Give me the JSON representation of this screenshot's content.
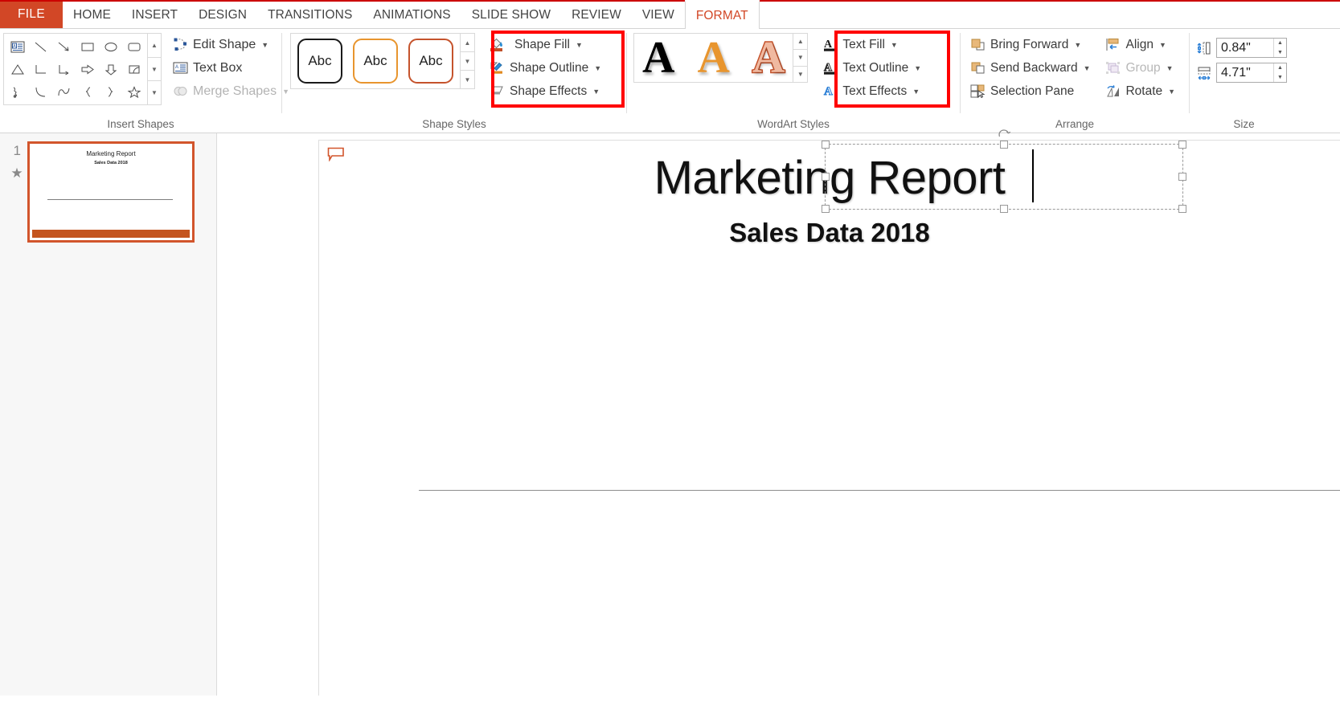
{
  "app": {
    "active_tab": "FORMAT"
  },
  "tabs": [
    {
      "label": "FILE",
      "id": "file",
      "active": false
    },
    {
      "label": "HOME",
      "id": "home",
      "active": false
    },
    {
      "label": "INSERT",
      "id": "insert",
      "active": false
    },
    {
      "label": "DESIGN",
      "id": "design",
      "active": false
    },
    {
      "label": "TRANSITIONS",
      "id": "transitions",
      "active": false
    },
    {
      "label": "ANIMATIONS",
      "id": "animations",
      "active": false
    },
    {
      "label": "SLIDE SHOW",
      "id": "slide-show",
      "active": false
    },
    {
      "label": "REVIEW",
      "id": "review",
      "active": false
    },
    {
      "label": "VIEW",
      "id": "view",
      "active": false
    },
    {
      "label": "FORMAT",
      "id": "format",
      "active": true
    }
  ],
  "groups": {
    "insert_shapes": {
      "label": "Insert Shapes",
      "gallery_icons": [
        "textbox-shape-icon",
        "line-shape-icon",
        "arrow-line-shape-icon",
        "rectangle-shape-icon",
        "oval-shape-icon",
        "rounded-rectangle-shape-icon",
        "triangle-shape-icon",
        "elbow-connector-shape-icon",
        "elbow-arrow-connector-shape-icon",
        "right-arrow-shape-icon",
        "down-arrow-shape-icon",
        "pie-shape-icon",
        "scribble-shape-icon",
        "curve-shape-icon",
        "freeform-shape-icon",
        "left-brace-shape-icon",
        "right-brace-shape-icon",
        "star-shape-icon"
      ],
      "commands": [
        {
          "label": "Edit Shape",
          "icon": "edit-shape-icon",
          "caret": true,
          "disabled": false
        },
        {
          "label": "Text Box",
          "icon": "text-box-icon",
          "caret": false,
          "disabled": false
        },
        {
          "label": "Merge Shapes",
          "icon": "merge-shapes-icon",
          "caret": true,
          "disabled": true
        }
      ]
    },
    "shape_styles": {
      "label": "Shape Styles",
      "thumbnails": [
        {
          "text": "Abc",
          "outline": "#1a1a1a"
        },
        {
          "text": "Abc",
          "outline": "#e8952e"
        },
        {
          "text": "Abc",
          "outline": "#c5532c"
        }
      ],
      "commands": [
        {
          "label": "Shape Fill",
          "icon": "shape-fill-icon",
          "caret": true,
          "disabled": false
        },
        {
          "label": "Shape Outline",
          "icon": "shape-outline-icon",
          "caret": true,
          "disabled": false
        },
        {
          "label": "Shape Effects",
          "icon": "shape-effects-icon",
          "caret": true,
          "disabled": false
        }
      ],
      "has_dialog_launcher": true
    },
    "wordart_styles": {
      "label": "WordArt Styles",
      "thumbnails": [
        {
          "glyph": "A",
          "style": "black-fill"
        },
        {
          "glyph": "A",
          "style": "orange-fill"
        },
        {
          "glyph": "A",
          "style": "peach-fill-dark-orange-outline"
        }
      ],
      "commands": [
        {
          "label": "Text Fill",
          "icon": "text-fill-icon",
          "caret": true,
          "disabled": false
        },
        {
          "label": "Text Outline",
          "icon": "text-outline-icon",
          "caret": true,
          "disabled": false
        },
        {
          "label": "Text Effects",
          "icon": "text-effects-icon",
          "caret": true,
          "disabled": false
        }
      ],
      "has_dialog_launcher": true
    },
    "arrange": {
      "label": "Arrange",
      "commands_left": [
        {
          "label": "Bring Forward",
          "icon": "bring-forward-icon",
          "caret": true,
          "disabled": false
        },
        {
          "label": "Send Backward",
          "icon": "send-backward-icon",
          "caret": true,
          "disabled": false
        },
        {
          "label": "Selection Pane",
          "icon": "selection-pane-icon",
          "caret": false,
          "disabled": false
        }
      ],
      "commands_right": [
        {
          "label": "Align",
          "icon": "align-icon",
          "caret": true,
          "disabled": false
        },
        {
          "label": "Group",
          "icon": "group-icon",
          "caret": true,
          "disabled": true
        },
        {
          "label": "Rotate",
          "icon": "rotate-icon",
          "caret": true,
          "disabled": false
        }
      ],
      "has_dialog_launcher": true
    },
    "size": {
      "label": "Size",
      "height": {
        "label_icon": "shape-height-icon",
        "value": "0.84\""
      },
      "width": {
        "label_icon": "shape-width-icon",
        "value": "4.71\""
      },
      "has_dialog_launcher": true
    }
  },
  "annotations": {
    "color": "#ff0000",
    "boxes": [
      {
        "name": "shape-fill-outline-effects-highlight"
      },
      {
        "name": "text-fill-outline-effects-highlight"
      }
    ]
  },
  "thumbnail_pane": {
    "slides": [
      {
        "number": "1",
        "title": "Marketing Report",
        "subtitle": "Sales Data 2018",
        "has_animation_star": true,
        "selected": true
      }
    ]
  },
  "slide": {
    "title": "Marketing Report",
    "subtitle": "Sales Data 2018",
    "comment_marker": "comment-icon",
    "selection": {
      "active": true,
      "target": "title-placeholder",
      "text_cursor_visible": true
    }
  },
  "colors": {
    "accent": "#d24726",
    "tab_active_text": "#d24726",
    "annotation_red": "#ff0000",
    "theme_orange": "#e8952e",
    "slide_footer_bar": "#c4551f"
  }
}
